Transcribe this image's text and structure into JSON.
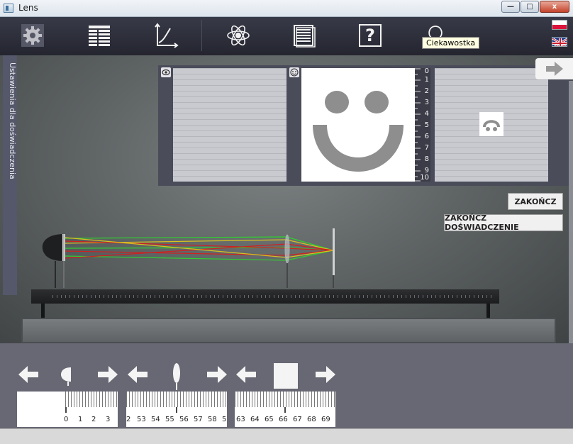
{
  "window": {
    "title": "Lens",
    "minimize_glyph": "—",
    "maximize_glyph": "□",
    "close_glyph": "x"
  },
  "toolbar": {
    "items": [
      {
        "icon": "gear-icon"
      },
      {
        "icon": "table-icon"
      },
      {
        "icon": "graph-icon"
      },
      {
        "icon": "atom-icon"
      },
      {
        "icon": "document-icon"
      },
      {
        "icon": "help-icon",
        "label": "?"
      },
      {
        "icon": "lightbulb-icon"
      }
    ],
    "tooltip": "Ciekawostka",
    "flags": [
      "flag-pl-icon",
      "flag-uk-icon"
    ]
  },
  "side_panel": {
    "label": "Ustawienia dla doświadczenia"
  },
  "view": {
    "ruler_numbers": [
      "0",
      "1",
      "2",
      "3",
      "4",
      "5",
      "6",
      "7",
      "8",
      "9",
      "10"
    ]
  },
  "buttons": {
    "end": "ZAKOŃCZ",
    "end_experiment": "ZAKOŃCZ DOŚWIADCZENIE"
  },
  "sliders": [
    {
      "name": "source",
      "ticks": [
        "0",
        "1",
        "2",
        "3"
      ]
    },
    {
      "name": "lens",
      "ticks": [
        "2",
        "53",
        "54",
        "55",
        "56",
        "57",
        "58",
        "5"
      ]
    },
    {
      "name": "screen",
      "ticks": [
        "63",
        "64",
        "65",
        "66",
        "67",
        "68",
        "69"
      ]
    }
  ],
  "colors": {
    "toolbar": "#2f303c",
    "panel": "#4b4c5a",
    "bottom": "#676873",
    "ray_green": "#2fd02f",
    "ray_red": "#d02020",
    "ray_yellow": "#d8c020"
  }
}
